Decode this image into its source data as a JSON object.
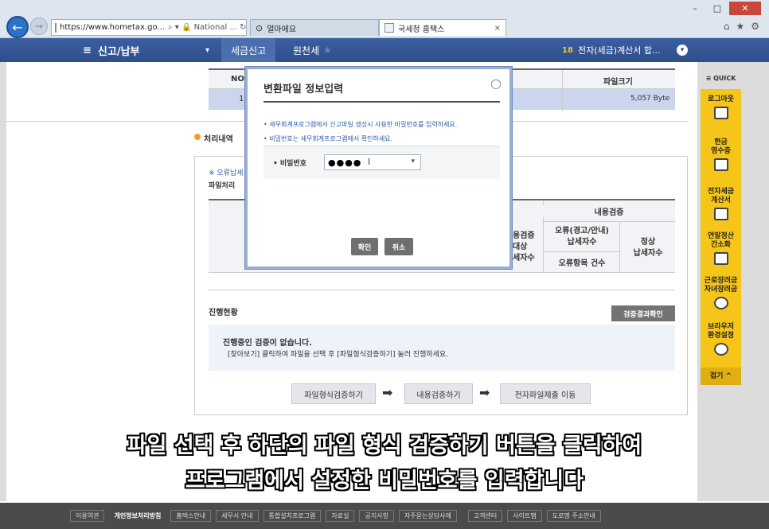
{
  "browser": {
    "address": "https://www.hometax.go...",
    "address_icons": "⌕ ▾ 🔒 National ... ↻",
    "tabs": [
      {
        "label": "얼마에요"
      },
      {
        "label": "국세청 홈택스"
      }
    ],
    "tab_close": "×",
    "controls": {
      "minimize": "–",
      "maximize": "□",
      "close": "✕"
    },
    "tool_icons": {
      "home": "⌂",
      "favorites": "★",
      "settings": "⚙"
    }
  },
  "topnav": {
    "menu_icon": "≡",
    "menu_label": "신고/납부",
    "dropdown": "▾",
    "crumb1": "세금신고",
    "crumb2": "원천세",
    "star": "★",
    "right_num": "18",
    "right_label": "전자(세금)계산서 합...",
    "right_dd": "▾"
  },
  "file_table": {
    "col_no": "NO",
    "col_size": "파일크기",
    "row_no": "1",
    "row_size": "5,057 Byte"
  },
  "process": {
    "section_title": "처리내역",
    "error_note": "※ 오류납세",
    "file_proc": "파일처리",
    "content_verify": "내용검증",
    "verify_target": "용검증\n대상\n세자수",
    "error_taxpayers": "오류(경고/안내)\n납세자수",
    "normal_taxpayers": "정상\n납세자수",
    "error_items": "오류항목 건수"
  },
  "progress": {
    "title": "진행현황",
    "result_button": "검증결과확인",
    "status": "진행중인 검증이 없습니다.",
    "instruction": "[찾아보기] 클릭하여 파일을 선택 후 [파일형식검증하기] 눌러 진행하세요."
  },
  "steps": {
    "step1": "파일형식검증하기",
    "step2": "내용검증하기",
    "step3": "전자파일제출 이동",
    "arrow": "➡"
  },
  "quick": {
    "title": "≡ QUICK",
    "items": [
      {
        "label": "로그아웃"
      },
      {
        "label": "현금\n영수증"
      },
      {
        "label": "전자세금\n계산서"
      },
      {
        "label": "연말정산\n간소화"
      },
      {
        "label": "근로장려금\n자녀장려금"
      },
      {
        "label": "브라우저\n환경설정"
      }
    ],
    "fold": "접기 ^"
  },
  "modal": {
    "title": "변환파일 정보입력",
    "close": "○",
    "note1": "• 세무회계프로그램에서 신고파일 생성시 사용한 비밀번호를 입력하세요.",
    "note2": "• 비밀번호는 세무회계프로그램에서 확인하세요.",
    "pw_label": "• 비밀번호",
    "pw_value": "●●●●",
    "pw_dd": "▾",
    "confirm": "확인",
    "cancel": "취소"
  },
  "subtitle": {
    "line1": "파일 선택 후 하단의 파일 형식 검증하기 버튼을 클릭하여",
    "line2": "프로그램에서 설정한 비밀번호를 입력합니다"
  },
  "footer": {
    "items": [
      "이용약관",
      "개인정보처리방침",
      "홈택스안내",
      "세무서 안내",
      "통합설치프로그램",
      "자료실",
      "공지사항",
      "자주묻는상담사례",
      "고객센터",
      "사이트맵",
      "도로명 주소안내"
    ]
  }
}
